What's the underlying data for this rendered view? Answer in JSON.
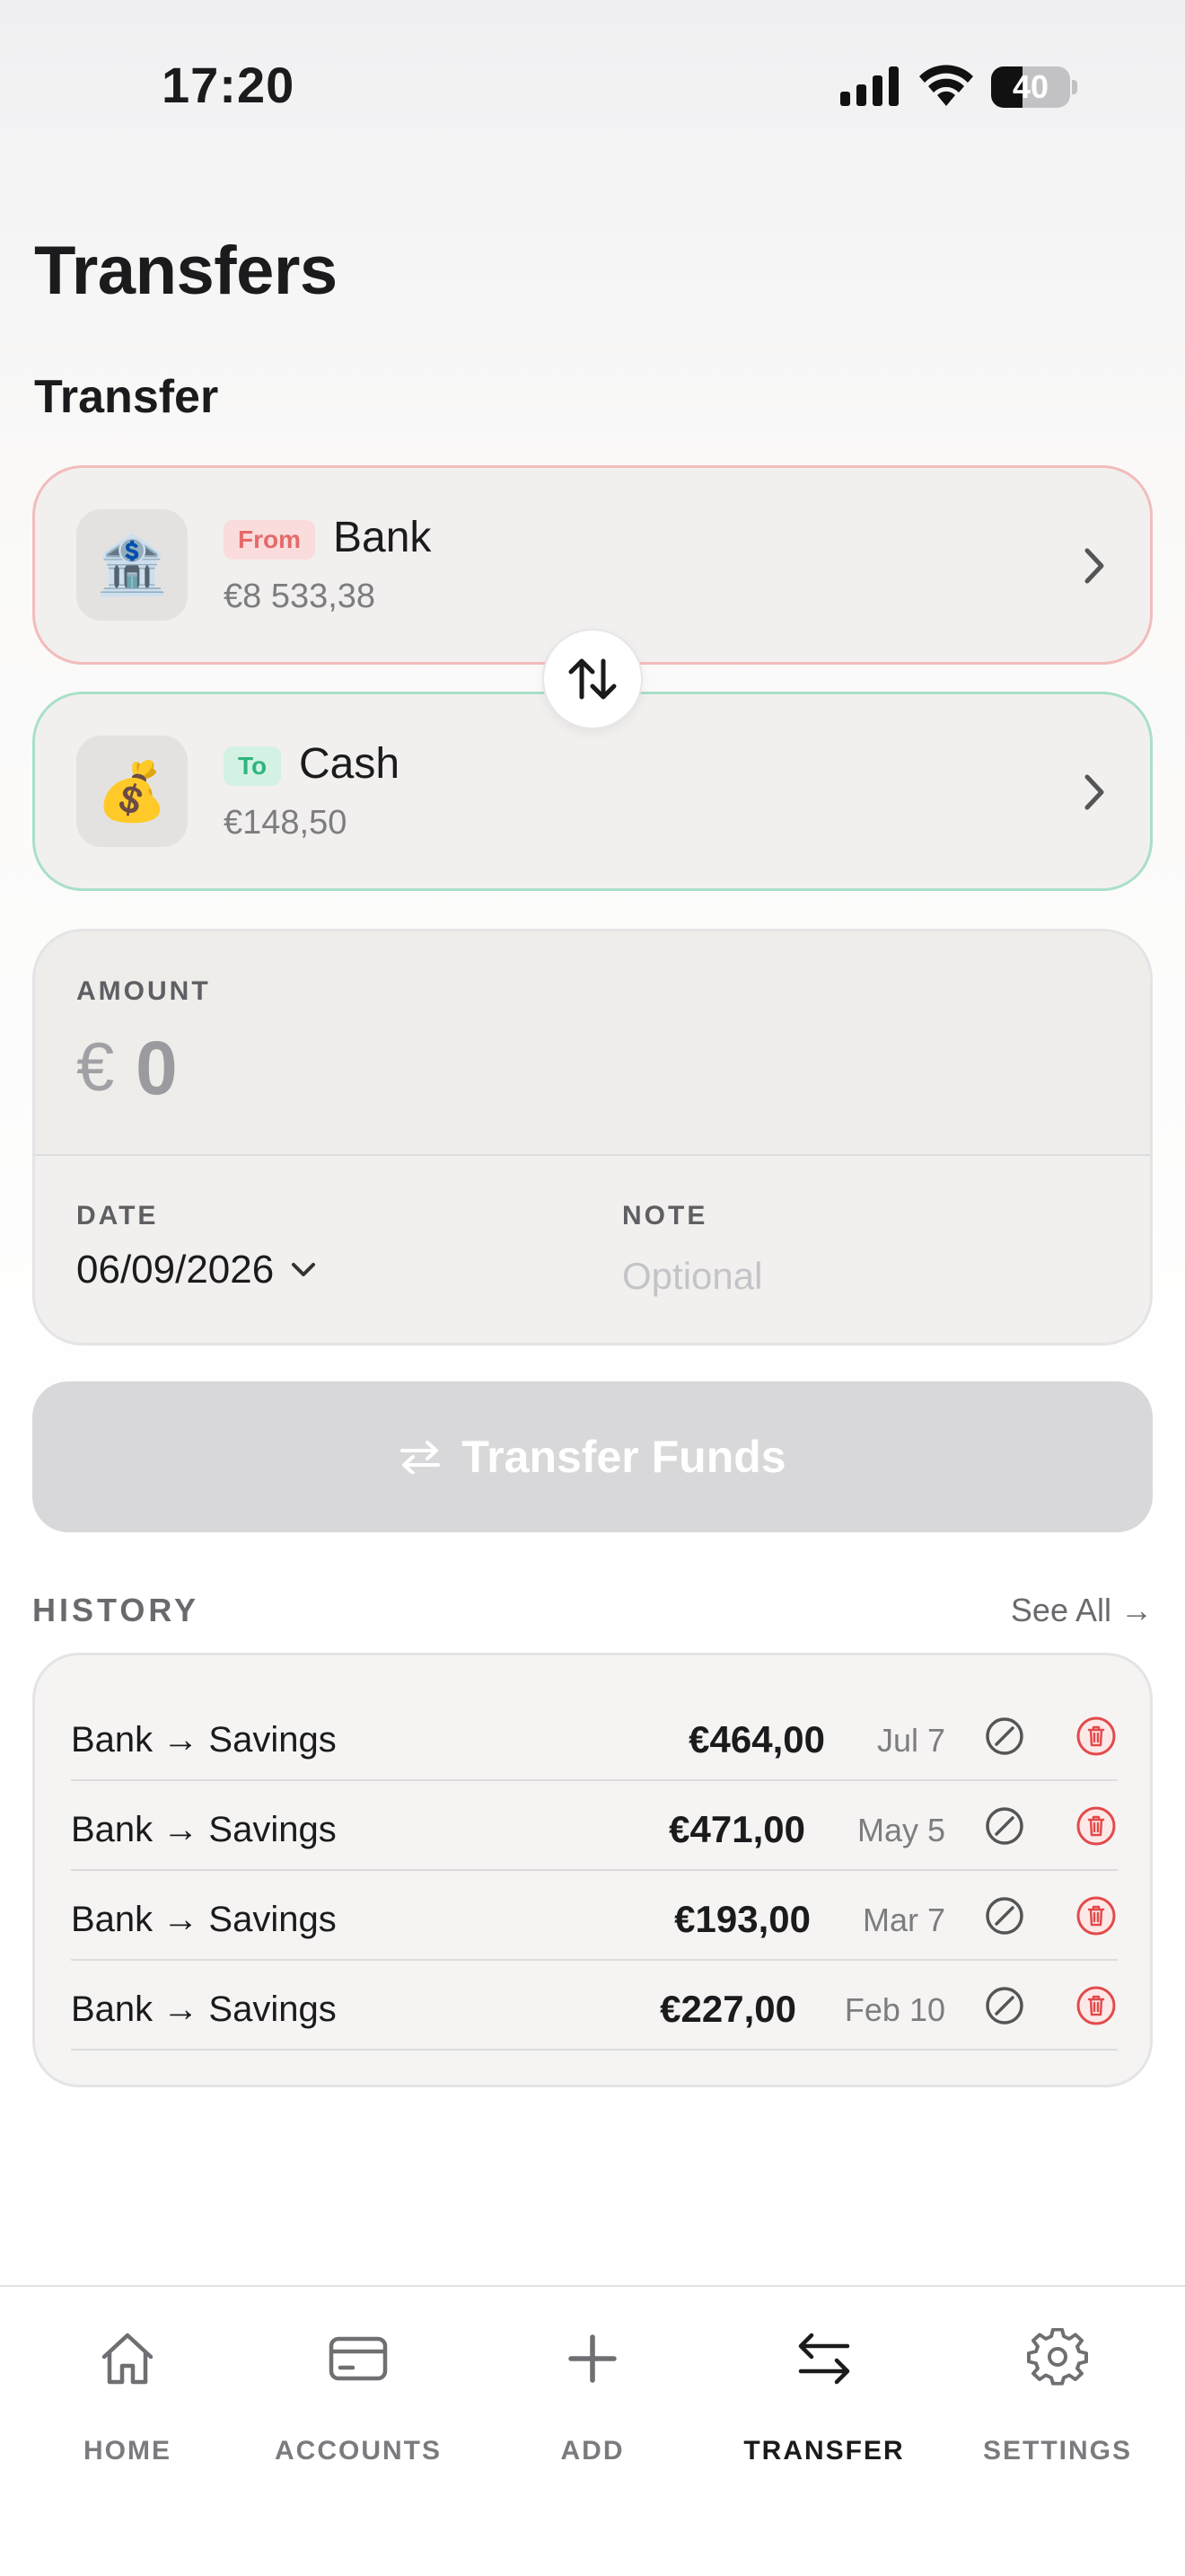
{
  "status_bar": {
    "time": "17:20",
    "battery": "40",
    "battery_level": 0.4
  },
  "page_title": "Transfers",
  "section_title": "Transfer",
  "from_account": {
    "badge": "From",
    "name": "Bank",
    "balance": "€8 533,38",
    "icon": "bank-emoji"
  },
  "to_account": {
    "badge": "To",
    "name": "Cash",
    "balance": "€148,50",
    "icon": "money-bag-emoji"
  },
  "amount": {
    "label": "AMOUNT",
    "currency": "€",
    "value": "0"
  },
  "date": {
    "label": "DATE",
    "value": "06/09/2026"
  },
  "note": {
    "label": "NOTE",
    "placeholder": "Optional",
    "value": ""
  },
  "transfer_button": {
    "label": "Transfer Funds",
    "icon": "swap-arrows-icon"
  },
  "history": {
    "title": "HISTORY",
    "see_all": "See All →",
    "rows": [
      {
        "description": "Bank → Savings",
        "amount": "€464,00",
        "date": "Jul 7"
      },
      {
        "description": "Bank → Savings",
        "amount": "€471,00",
        "date": "May 5"
      },
      {
        "description": "Bank → Savings",
        "amount": "€193,00",
        "date": "Mar 7"
      },
      {
        "description": "Bank → Savings",
        "amount": "€227,00",
        "date": "Feb 10"
      }
    ]
  },
  "tabs": [
    {
      "label": "HOME",
      "icon": "home-icon",
      "active": false
    },
    {
      "label": "ACCOUNTS",
      "icon": "card-icon",
      "active": false
    },
    {
      "label": "ADD",
      "icon": "plus-icon",
      "active": false
    },
    {
      "label": "TRANSFER",
      "icon": "transfer-icon",
      "active": true
    },
    {
      "label": "SETTINGS",
      "icon": "gear-icon",
      "active": false
    }
  ],
  "colors": {
    "from_border": "#f2bcbc",
    "to_border": "#a8e0c8",
    "delete_red": "#e24b4b",
    "disabled_button": "#d8d8da"
  }
}
